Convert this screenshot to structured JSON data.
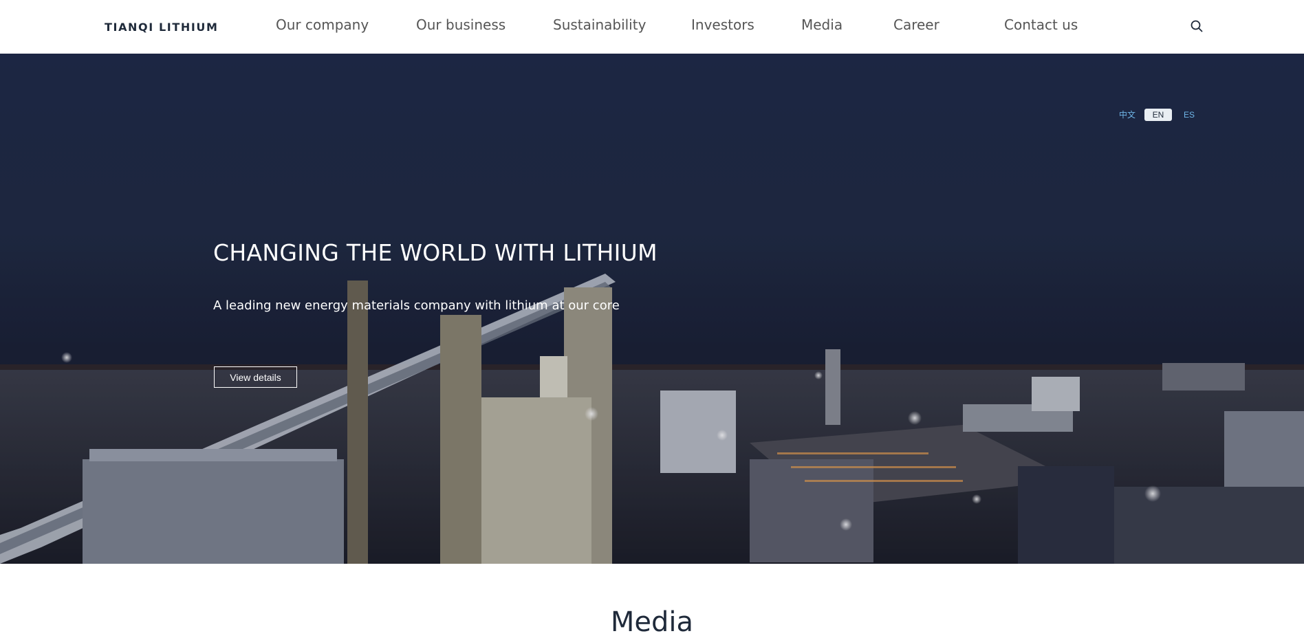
{
  "header": {
    "logo": "TIANQI LITHIUM",
    "nav": [
      "Our company",
      "Our business",
      "Sustainability",
      "Investors",
      "Media",
      "Career",
      "Contact us"
    ]
  },
  "languages": {
    "zh": "中文",
    "en": "EN",
    "es": "ES",
    "active": "EN"
  },
  "hero": {
    "title": "CHANGING THE WORLD WITH LITHIUM",
    "subtitle": "A leading new energy materials company with lithium at our core",
    "button": "View details"
  },
  "sections": {
    "media_title": "Media"
  },
  "colors": {
    "accent": "#6fb6e8",
    "nav_text": "#555555",
    "dark": "#1f2a3a"
  },
  "icons": {
    "search": "search-icon"
  }
}
